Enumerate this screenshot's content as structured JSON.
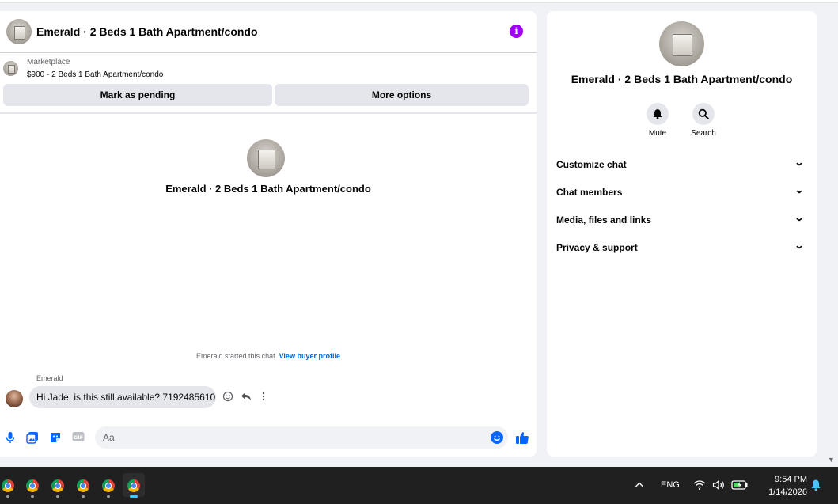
{
  "chat": {
    "title": "Emerald · 2 Beds 1 Bath Apartment/condo",
    "info_icon": "info-icon",
    "marketplace": {
      "label": "Marketplace",
      "listing": "$900 - 2 Beds 1 Bath Apartment/condo"
    },
    "buttons": {
      "mark_pending": "Mark as pending",
      "more_options": "More options"
    },
    "center_title": "Emerald · 2 Beds 1 Bath Apartment/condo",
    "started_text": "Emerald started this chat.",
    "buyer_profile_link": "View buyer profile",
    "messages": [
      {
        "sender": "Emerald",
        "text": "Hi Jade, is this still available? 7192485610"
      }
    ],
    "composer": {
      "placeholder": "Aa"
    },
    "colors": {
      "accent": "#0866ff",
      "info": "#a100f5"
    }
  },
  "info_panel": {
    "title": "Emerald · 2 Beds 1 Bath Apartment/condo",
    "actions": [
      {
        "label": "Mute",
        "icon": "bell-icon"
      },
      {
        "label": "Search",
        "icon": "search-icon"
      }
    ],
    "sections": [
      {
        "label": "Customize chat"
      },
      {
        "label": "Chat members"
      },
      {
        "label": "Media, files and links"
      },
      {
        "label": "Privacy & support"
      }
    ]
  },
  "taskbar": {
    "language": "ENG",
    "time": "9:54 PM",
    "date": "1/14/2026"
  }
}
